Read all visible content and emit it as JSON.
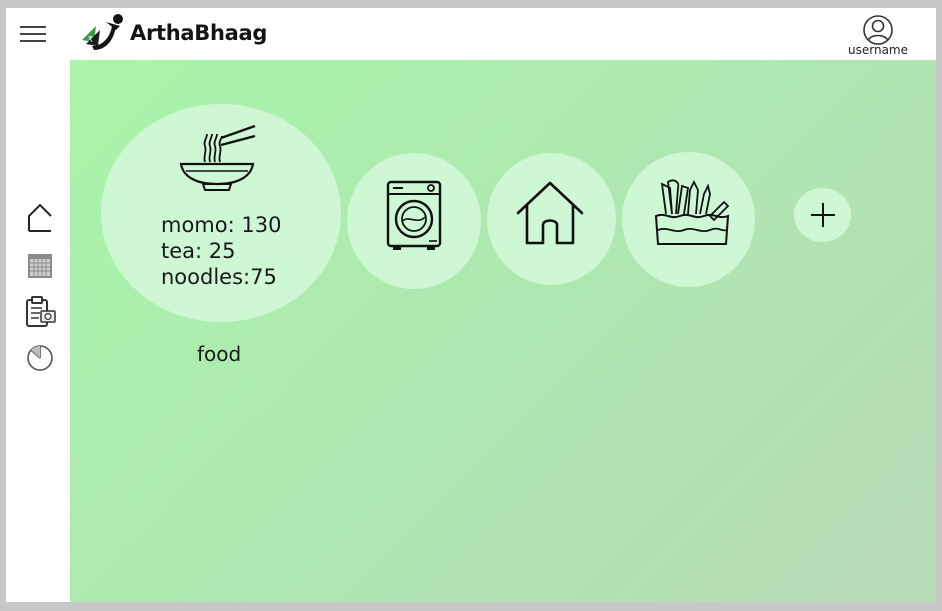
{
  "app": {
    "name": "ArthaBhaag"
  },
  "header": {
    "username": "username"
  },
  "sidebar": {
    "items": [
      {
        "icon": "home-icon"
      },
      {
        "icon": "calendar-icon"
      },
      {
        "icon": "clipboard-money-icon"
      },
      {
        "icon": "pie-chart-icon"
      }
    ]
  },
  "categories": [
    {
      "name": "food",
      "icon": "noodle-bowl-icon",
      "expenses": [
        {
          "text": "momo: 130"
        },
        {
          "text": "tea: 25"
        },
        {
          "text": "noodles:75"
        }
      ]
    },
    {
      "icon": "washing-machine-icon"
    },
    {
      "icon": "house-icon"
    },
    {
      "icon": "stationery-icon"
    }
  ],
  "add_button": {
    "icon": "plus-icon"
  },
  "colors": {
    "accent_light": "#cef7d4",
    "gradient_start": "#a9f5aa",
    "gradient_end": "#b6d9b6",
    "background": "#ffffff"
  }
}
